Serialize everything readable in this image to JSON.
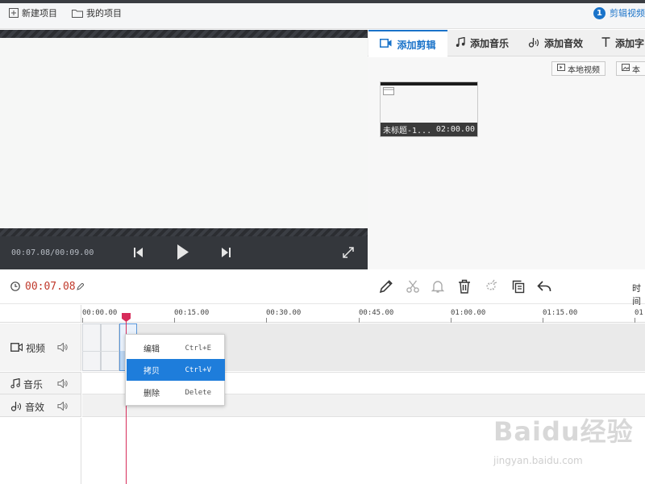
{
  "toolbar": {
    "new_project": "新建项目",
    "my_projects": "我的项目",
    "step_number": "1",
    "step_label": "剪辑视频"
  },
  "preview": {
    "timecode": "00:07.08/00:09.00"
  },
  "right_panel": {
    "tabs": [
      {
        "label": "添加剪辑",
        "icon": "video-camera-icon",
        "active": true
      },
      {
        "label": "添加音乐",
        "icon": "music-note-icon",
        "active": false
      },
      {
        "label": "添加音效",
        "icon": "sound-effect-icon",
        "active": false
      },
      {
        "label": "添加字",
        "icon": "text-t-icon",
        "active": false
      }
    ],
    "local_video_label": "本地视频",
    "local_image_label": "本",
    "clip": {
      "title": "未标题-1...",
      "duration": "02:00.00"
    }
  },
  "edit_bar": {
    "current_time": "00:07.08",
    "time_label": "时间"
  },
  "ruler": {
    "labels": [
      "00:00.00",
      "00:15.00",
      "00:30.00",
      "00:45.00",
      "01:00.00",
      "01:15.00",
      "01:"
    ]
  },
  "tracks": [
    {
      "name": "视频",
      "icon": "video-camera-icon"
    },
    {
      "name": "音乐",
      "icon": "music-note-icon"
    },
    {
      "name": "音效",
      "icon": "sound-effect-icon"
    }
  ],
  "context_menu": {
    "items": [
      {
        "label": "编辑",
        "shortcut": "Ctrl+E",
        "highlighted": false
      },
      {
        "label": "拷贝",
        "shortcut": "Ctrl+V",
        "highlighted": true
      },
      {
        "label": "删除",
        "shortcut": "Delete",
        "highlighted": false
      }
    ]
  },
  "watermark": {
    "text": "Baidu经验",
    "sub": "jingyan.baidu.com"
  },
  "colors": {
    "accent": "#1a73c9",
    "playhead": "#d72c5a",
    "menu_highlight": "#1e7ddb"
  }
}
